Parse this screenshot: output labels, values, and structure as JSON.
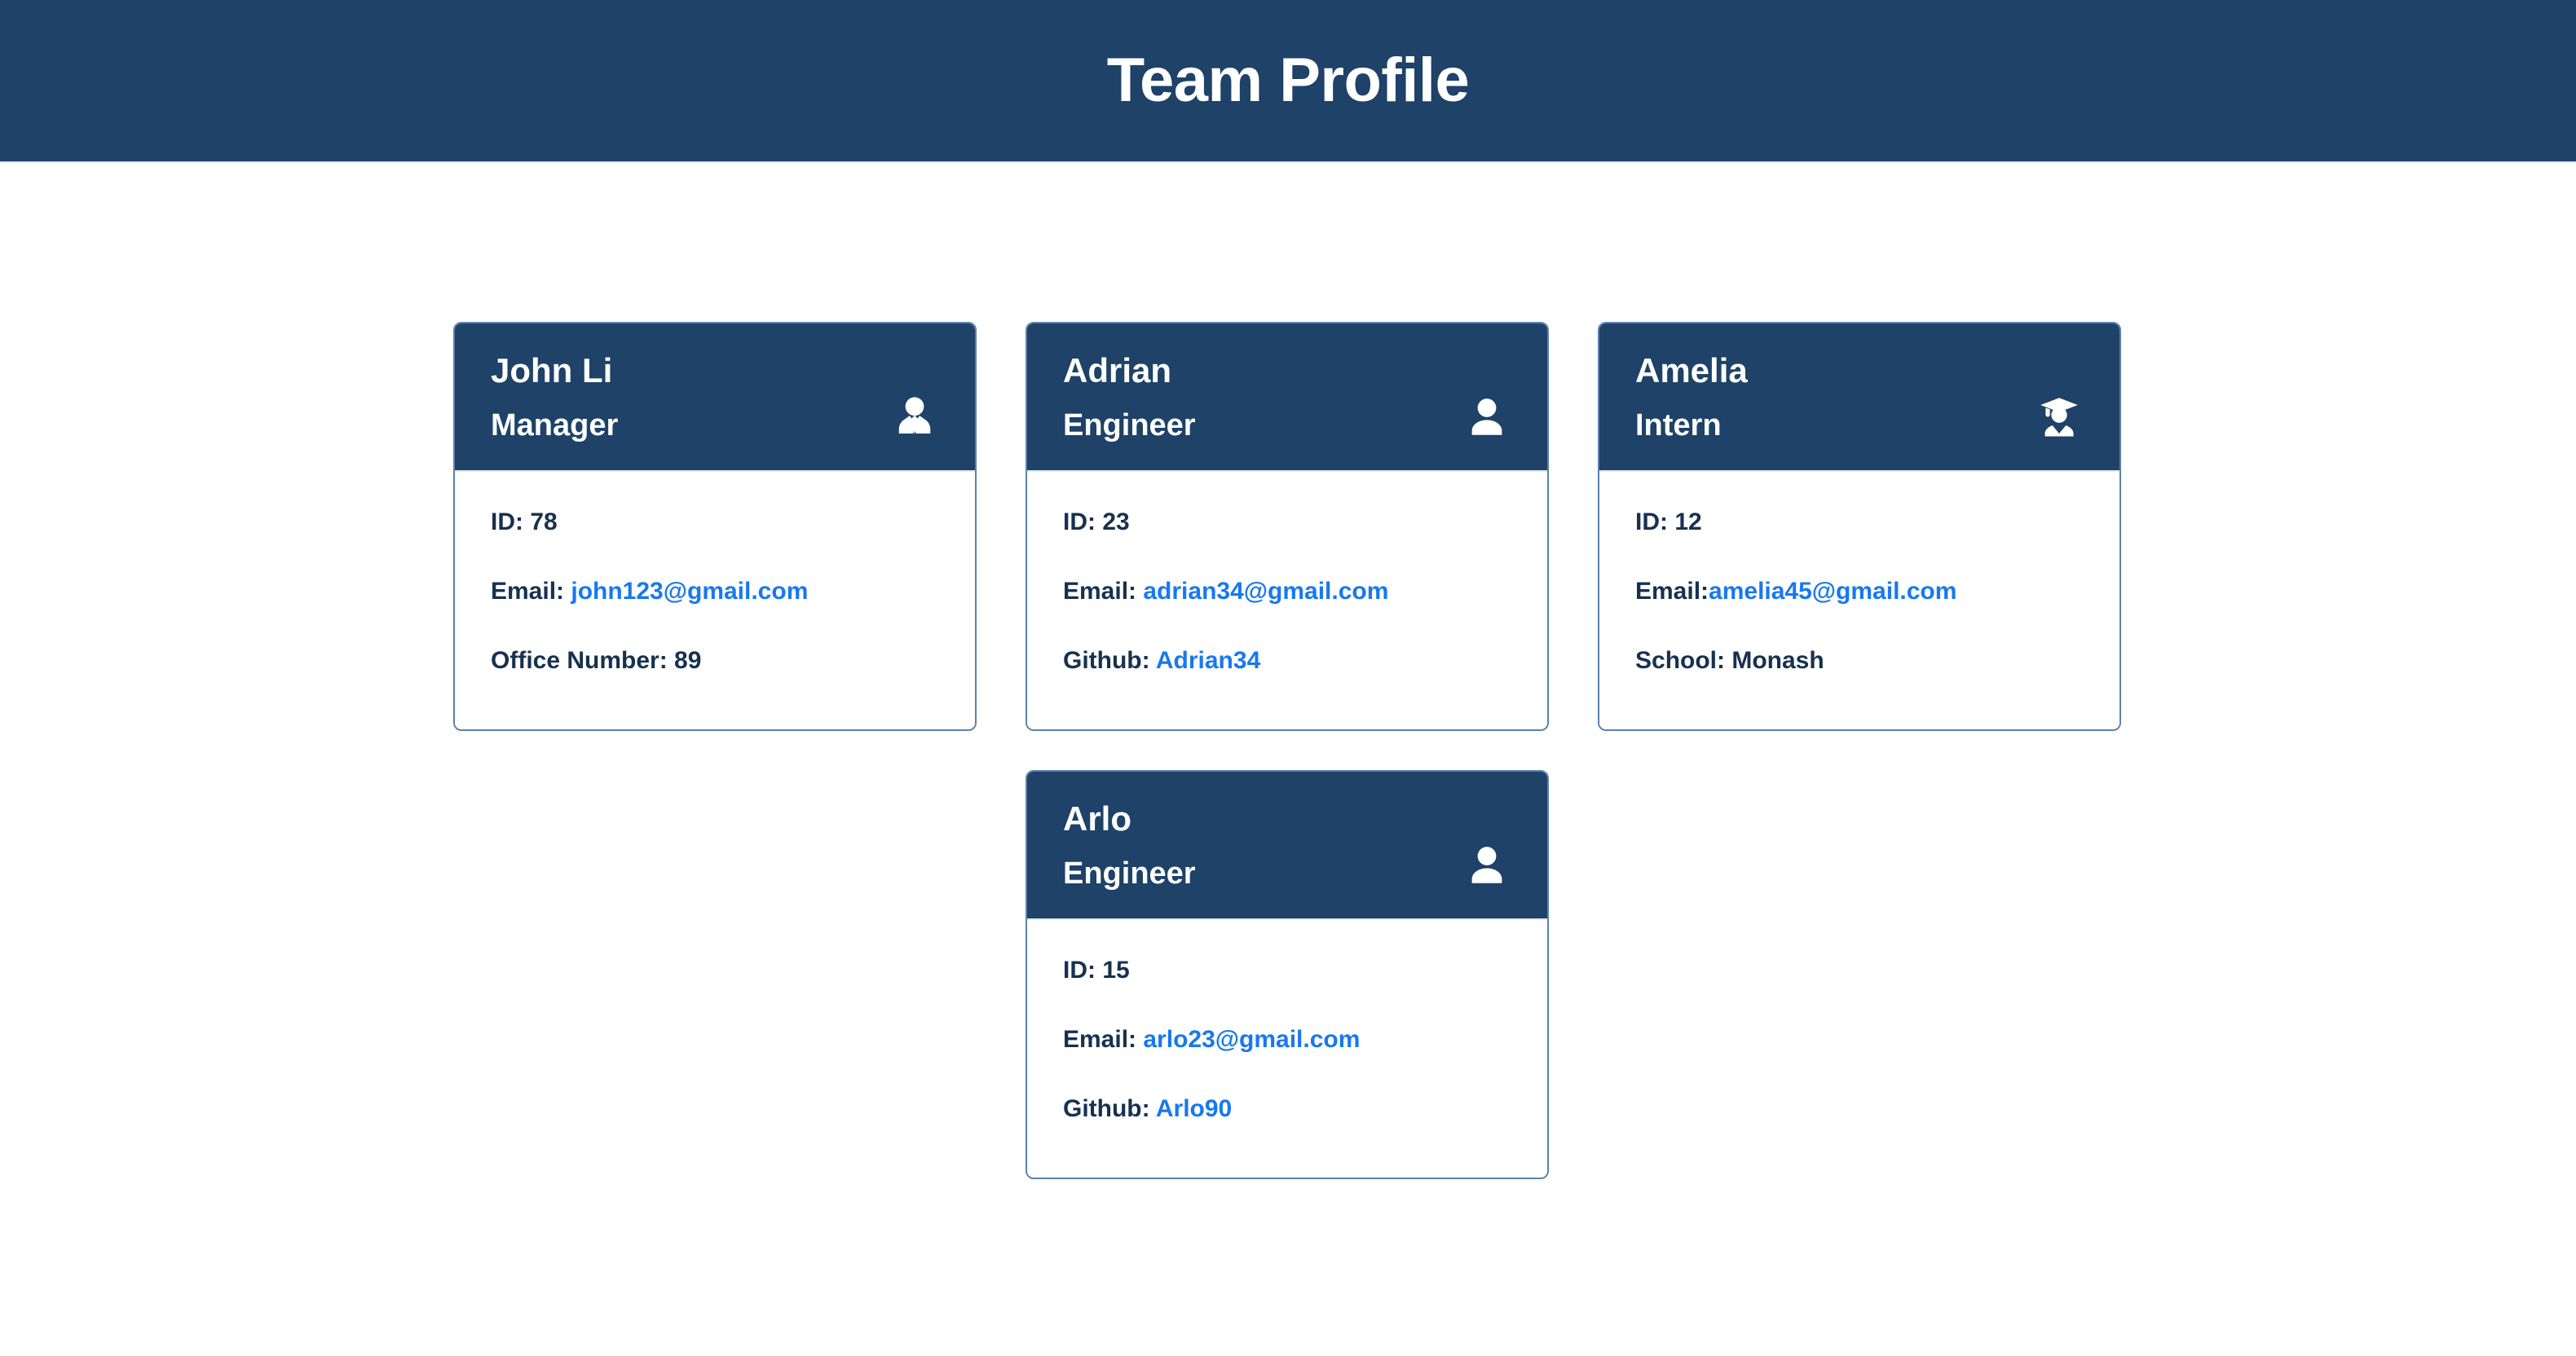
{
  "header": {
    "title": "Team Profile",
    "background_color": "#1e4268",
    "text_color": "#ffffff"
  },
  "theme": {
    "navy": "#1e4268",
    "card_border": "#5b82ad",
    "link_blue": "#1878f0",
    "body_text": "#17314f",
    "page_background": "#ffffff"
  },
  "cards": [
    {
      "name": "John Li",
      "role": "Manager",
      "icon": "user-tie-icon",
      "fields": [
        {
          "label": "ID:",
          "separator": " ",
          "value": "78",
          "is_link": false
        },
        {
          "label": "Email:",
          "separator": " ",
          "value": "john123@gmail.com",
          "is_link": true
        },
        {
          "label": "Office Number:",
          "separator": " ",
          "value": "89",
          "is_link": false
        }
      ]
    },
    {
      "name": "Adrian",
      "role": "Engineer",
      "icon": "user-icon",
      "fields": [
        {
          "label": "ID:",
          "separator": " ",
          "value": "23",
          "is_link": false
        },
        {
          "label": "Email:",
          "separator": " ",
          "value": "adrian34@gmail.com",
          "is_link": true
        },
        {
          "label": "Github:",
          "separator": " ",
          "value": "Adrian34",
          "is_link": true
        }
      ]
    },
    {
      "name": "Amelia",
      "role": "Intern",
      "icon": "user-graduate-icon",
      "fields": [
        {
          "label": "ID:",
          "separator": " ",
          "value": "12",
          "is_link": false
        },
        {
          "label": "Email:",
          "separator": "",
          "value": "amelia45@gmail.com",
          "is_link": true
        },
        {
          "label": "School:",
          "separator": " ",
          "value": "Monash",
          "is_link": false
        }
      ]
    },
    {
      "name": "Arlo",
      "role": "Engineer",
      "icon": "user-icon",
      "fields": [
        {
          "label": "ID:",
          "separator": " ",
          "value": "15",
          "is_link": false
        },
        {
          "label": "Email:",
          "separator": " ",
          "value": "arlo23@gmail.com",
          "is_link": true
        },
        {
          "label": "Github:",
          "separator": " ",
          "value": "Arlo90",
          "is_link": true
        }
      ]
    }
  ],
  "layout": {
    "row_1_card_indexes": [
      0,
      1,
      2
    ],
    "row_2_card_indexes": [
      3
    ]
  }
}
